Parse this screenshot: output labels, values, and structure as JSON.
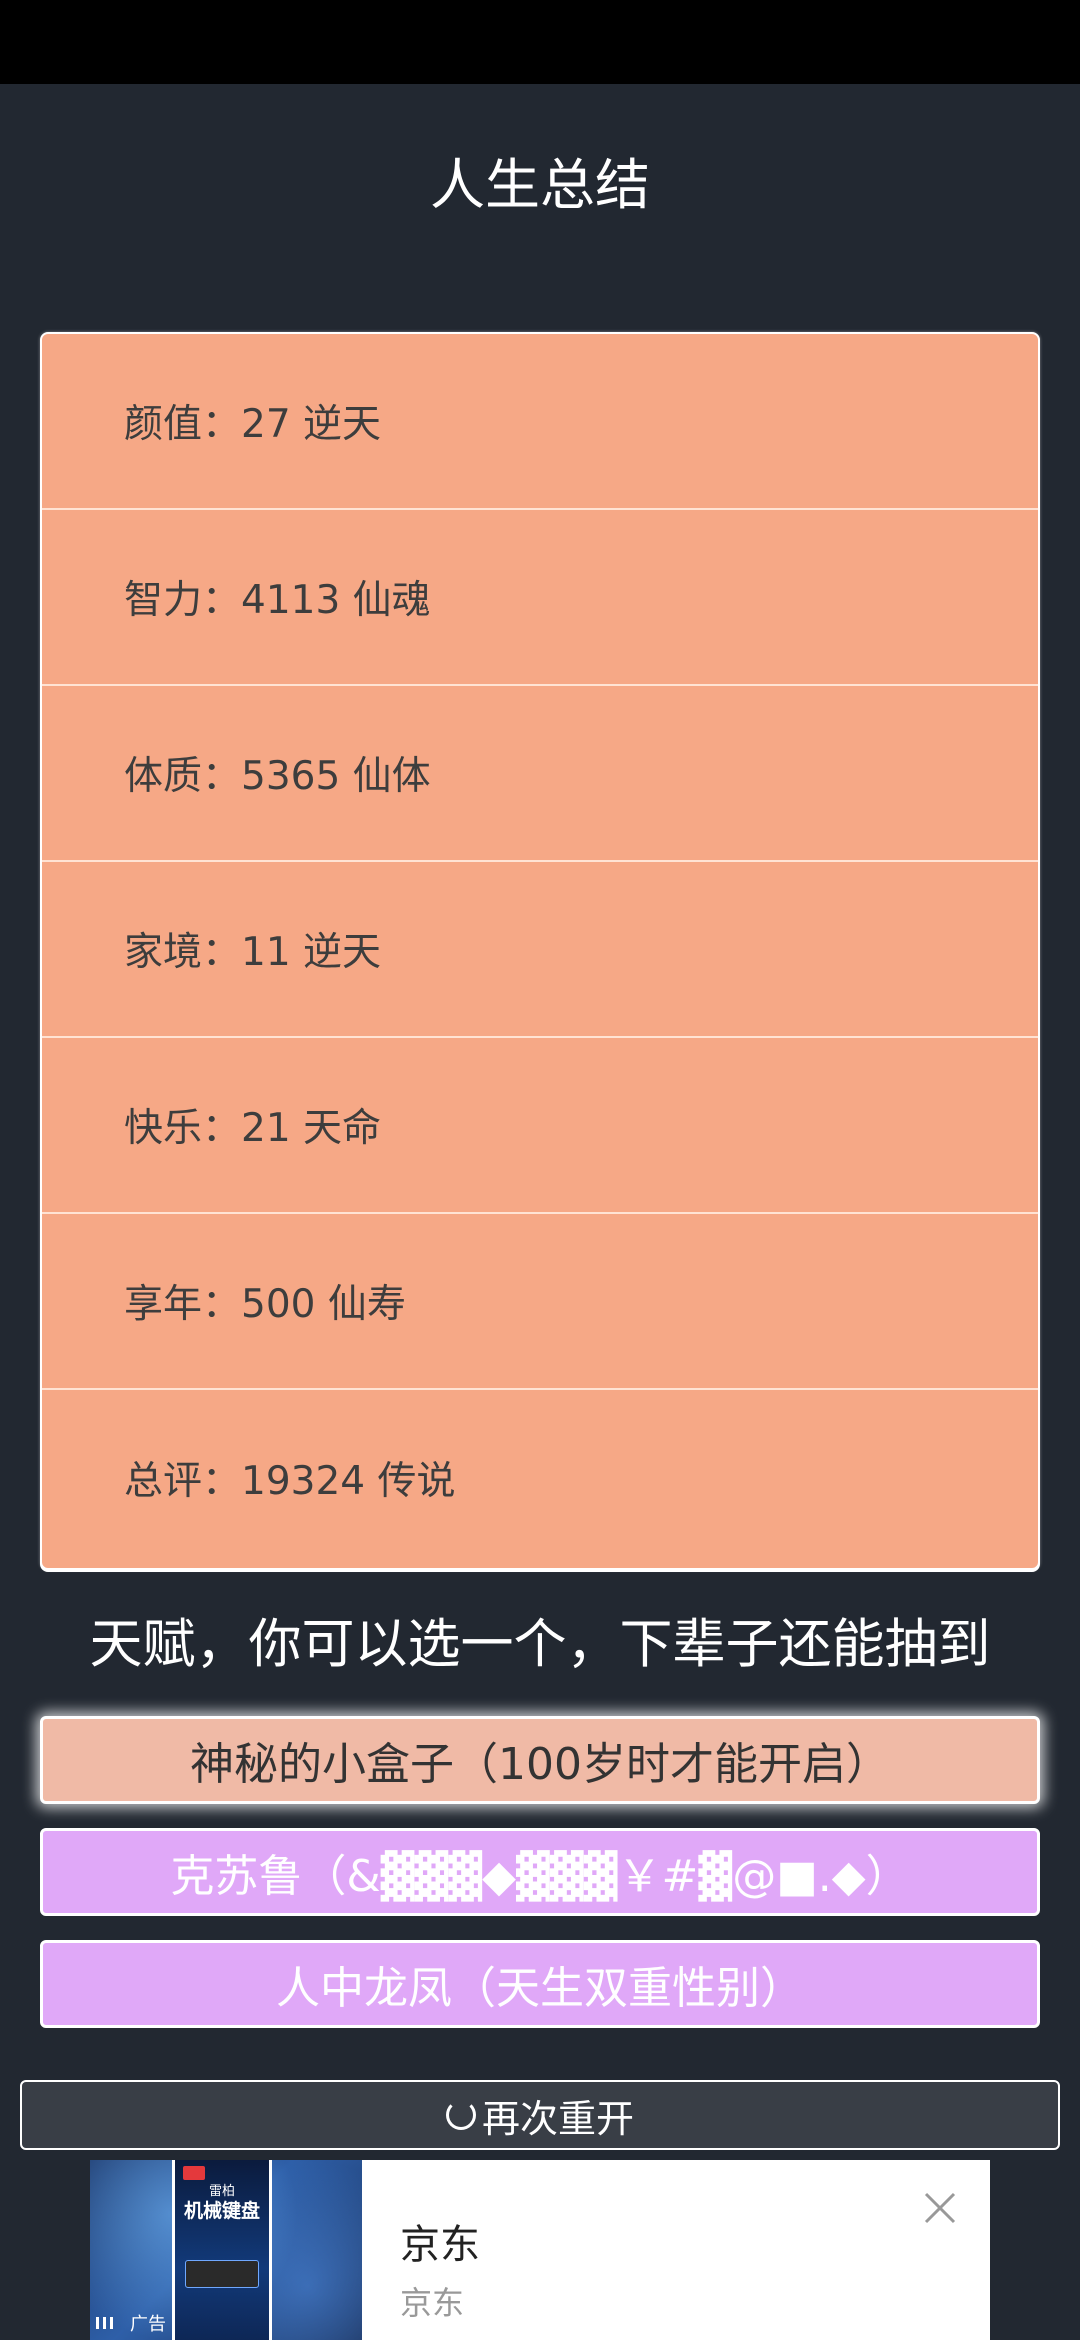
{
  "header": {
    "title": "人生总结"
  },
  "summary": {
    "rows": [
      {
        "label": "颜值：27 逆天"
      },
      {
        "label": "智力：4113 仙魂"
      },
      {
        "label": "体质：5365 仙体"
      },
      {
        "label": "家境：11 逆天"
      },
      {
        "label": "快乐：21 天命"
      },
      {
        "label": "享年：500 仙寿"
      },
      {
        "label": "总评：19324 传说"
      }
    ]
  },
  "talents": {
    "prompt": "天赋，你可以选一个，下辈子还能抽到",
    "items": [
      {
        "label": "神秘的小盒子（100岁时才能开启）"
      },
      {
        "label": "克苏鲁（&▓▓▓◆▓▓▓￥#▓@■.◆）"
      },
      {
        "label": "人中龙凤（天生双重性别）"
      }
    ]
  },
  "restart": {
    "label": "再次重开"
  },
  "ad": {
    "brand": "京东",
    "subtitle": "京东",
    "badge": "广告",
    "poster_brand": "雷柏",
    "poster_title": "机械键盘"
  },
  "colors": {
    "background": "#222831",
    "summary_bg": "#f6a886",
    "selected_talent": "#f0baa6",
    "talent_bg": "#e0a8f8"
  }
}
